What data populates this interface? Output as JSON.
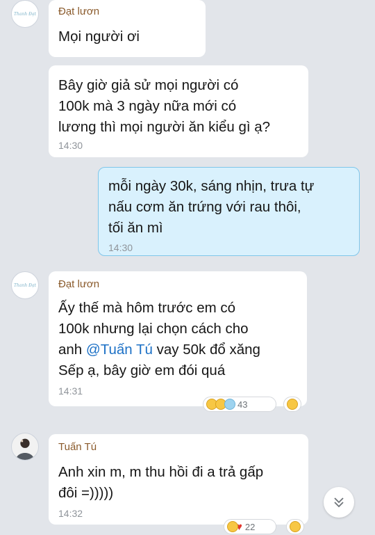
{
  "messages": [
    {
      "sender": "Đạt lươn",
      "text": "Mọi người ơi"
    },
    {
      "text": "Bây giờ giả sử mọi người có\n100k mà  3 ngày nữa mới có\nlương thì mọi người ăn kiểu gì ạ?",
      "time": "14:30"
    },
    {
      "text": "mỗi ngày 30k, sáng nhịn, trưa tự\nnấu cơm ăn trứng với rau thôi,\ntối ăn mì",
      "time": "14:30"
    },
    {
      "sender": "Đạt lươn",
      "line1": "Ấy thế mà hôm trước em có",
      "line2": "100k nhưng lại chọn cách cho",
      "line3_before": "anh ",
      "mention": "@Tuấn Tú",
      "line3_after": "  vay 50k đổ xăng",
      "line4": "Sếp ạ, bây giờ em đói quá",
      "time": "14:31",
      "reaction_count": "43"
    },
    {
      "sender": "Tuấn Tú",
      "text": "Anh xin m, m thu hồi đi a trả gấp\nđôi =)))))",
      "time": "14:32",
      "reaction_count": "22"
    }
  ],
  "avatar_brand": "Thanh Đạt",
  "icons": {
    "haha": "laughing-face-emoji",
    "wow": "surprised-face-emoji",
    "cry": "crying-face-emoji",
    "heart": "red-heart-emoji",
    "scroll": "chevron-double-down-icon"
  },
  "colors": {
    "outgoing_bubble": "#d9f1fd",
    "outgoing_border": "#7fc6ea",
    "sender_name": "#8a5a2b",
    "mention": "#1d71c6"
  }
}
